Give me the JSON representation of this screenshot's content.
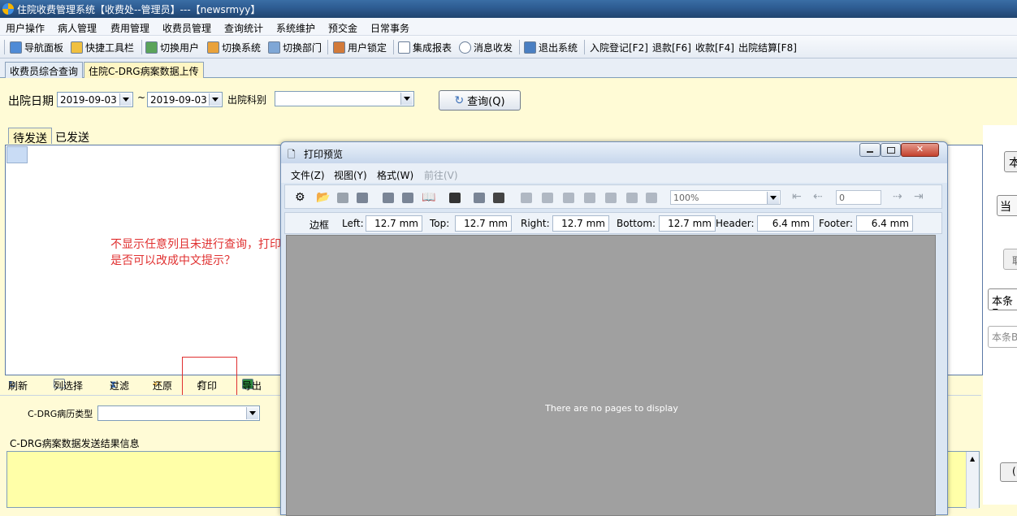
{
  "window": {
    "title": "住院收费管理系统【收费处--管理员】---【newsrmyy】"
  },
  "menu": [
    "用户操作",
    "病人管理",
    "费用管理",
    "收费员管理",
    "查询统计",
    "系统维护",
    "预交金",
    "日常事务"
  ],
  "toolbar": {
    "items": [
      "导航面板",
      "快捷工具栏",
      "切换用户",
      "切换系统",
      "切换部门",
      "用户锁定",
      "集成报表",
      "消息收发",
      "退出系统",
      "入院登记[F2]",
      "退款[F6]",
      "收款[F4]",
      "出院结算[F8]"
    ]
  },
  "tabs": [
    "收费员综合查询",
    "住院C-DRG病案数据上传"
  ],
  "filter": {
    "date_label": "出院日期",
    "date_from": "2019-09-03",
    "tilde": "~",
    "date_to": "2019-09-03",
    "dept_label": "出院科别",
    "dept_value": "",
    "query_button": "查询(Q)"
  },
  "subtabs": [
    "待发送",
    "已发送"
  ],
  "annotation": {
    "line1": "不显示任意列且未进行查询，打印提示没有英文的：没有页面可以显示",
    "line2": "是否可以改成中文提示？"
  },
  "grid_toolbar": [
    "刷新",
    "列选择",
    "过滤",
    "还原",
    "打印",
    "导出"
  ],
  "case_type": {
    "label": "C-DRG病历类型",
    "value": ""
  },
  "result_section": {
    "title": "C-DRG病案数据发送结果信息"
  },
  "right_panel": {
    "items": [
      "本",
      "当前",
      "取",
      "本条E",
      "本条B",
      "("
    ]
  },
  "print_preview": {
    "title": "打印预览",
    "menu": [
      "文件(Z)",
      "视图(Y)",
      "格式(W)",
      "前往(V)"
    ],
    "zoom": "100%",
    "page": "0",
    "margins": {
      "group_label": "边框",
      "left_label": "Left:",
      "left": "12.7 mm",
      "top_label": "Top:",
      "top": "12.7 mm",
      "right_label": "Right:",
      "right": "12.7 mm",
      "bottom_label": "Bottom:",
      "bottom": "12.7 mm",
      "header_label": "Header:",
      "header": "6.4 mm",
      "footer_label": "Footer:",
      "footer": "6.4 mm"
    },
    "empty_message": "There are no pages to display"
  }
}
